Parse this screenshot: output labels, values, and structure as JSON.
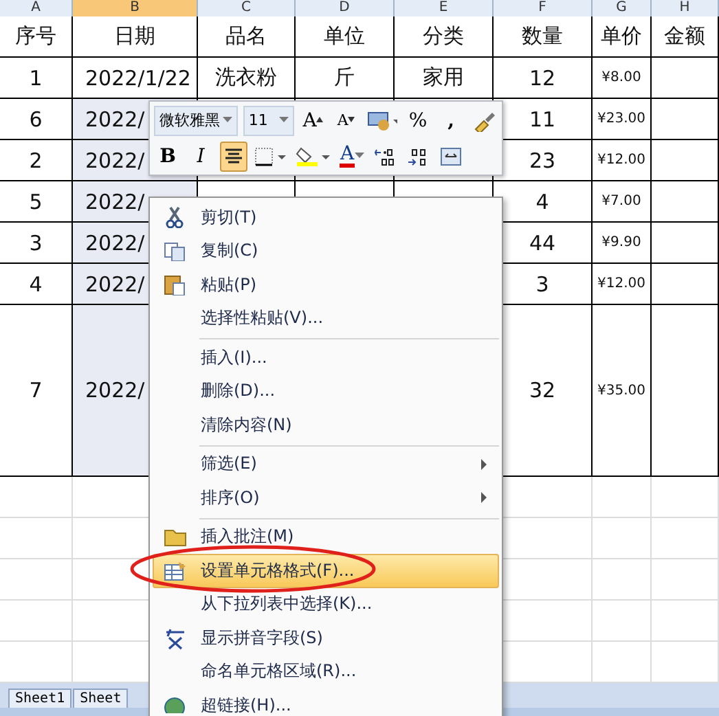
{
  "columns": [
    {
      "letter": "A",
      "selected": false
    },
    {
      "letter": "B",
      "selected": true
    },
    {
      "letter": "C",
      "selected": false
    },
    {
      "letter": "D",
      "selected": false
    },
    {
      "letter": "E",
      "selected": false
    },
    {
      "letter": "F",
      "selected": false
    },
    {
      "letter": "G",
      "selected": false
    },
    {
      "letter": "H",
      "selected": false
    }
  ],
  "header": [
    "序号",
    "日期",
    "品名",
    "单位",
    "分类",
    "数量",
    "单价",
    "金额"
  ],
  "rows": [
    {
      "cells": [
        "1",
        "2022/1/22",
        "洗衣粉",
        "斤",
        "家用",
        "12",
        "¥8.00",
        ""
      ],
      "selected": false,
      "tall": false
    },
    {
      "cells": [
        "6",
        "2022/",
        "",
        "",
        "",
        "11",
        "¥23.00",
        ""
      ],
      "selected": true,
      "tall": false
    },
    {
      "cells": [
        "2",
        "2022/",
        "",
        "",
        "",
        "23",
        "¥12.00",
        ""
      ],
      "selected": true,
      "tall": false
    },
    {
      "cells": [
        "5",
        "2022/",
        "",
        "",
        "",
        "4",
        "¥7.00",
        ""
      ],
      "selected": true,
      "tall": false
    },
    {
      "cells": [
        "3",
        "2022/",
        "",
        "",
        "",
        "44",
        "¥9.90",
        ""
      ],
      "selected": true,
      "tall": false
    },
    {
      "cells": [
        "4",
        "2022/",
        "",
        "",
        "",
        "3",
        "¥12.00",
        ""
      ],
      "selected": true,
      "tall": false
    },
    {
      "cells": [
        "7",
        "2022/",
        "",
        "",
        "",
        "32",
        "¥35.00",
        ""
      ],
      "selected": true,
      "tall": true
    }
  ],
  "sheet_tabs": [
    {
      "label": "Sheet1",
      "selected": false
    },
    {
      "label": "Sheet",
      "selected": false
    }
  ],
  "mini_toolbar": {
    "font": "微软雅黑",
    "size": "11",
    "row1": [
      {
        "kind": "grow",
        "label": "A"
      },
      {
        "kind": "shrink",
        "label": "A"
      },
      {
        "kind": "currency"
      },
      {
        "kind": "percent",
        "label": "%"
      },
      {
        "kind": "comma",
        "label": ","
      },
      {
        "kind": "brush"
      }
    ],
    "row2": [
      {
        "kind": "bold",
        "label": "B",
        "pressed": false
      },
      {
        "kind": "italic",
        "label": "I",
        "pressed": false
      },
      {
        "kind": "align",
        "pressed": true
      },
      {
        "kind": "border",
        "pressed": false
      },
      {
        "kind": "fill",
        "pressed": false
      },
      {
        "kind": "fontcolor",
        "label": "A",
        "pressed": false
      },
      {
        "kind": "incdec",
        "pressed": false
      },
      {
        "kind": "decdec",
        "pressed": false
      },
      {
        "kind": "merge",
        "pressed": false
      }
    ]
  },
  "context_menu": [
    {
      "kind": "cut",
      "label": "剪切(T)",
      "selected": false
    },
    {
      "kind": "copy",
      "label": "复制(C)",
      "selected": false
    },
    {
      "kind": "paste",
      "label": "粘贴(P)",
      "selected": false
    },
    {
      "kind": "plain",
      "label": "选择性粘贴(V)...",
      "selected": false
    },
    {
      "kind": "separator"
    },
    {
      "kind": "plain",
      "label": "插入(I)...",
      "selected": false
    },
    {
      "kind": "plain",
      "label": "删除(D)...",
      "selected": false
    },
    {
      "kind": "plain",
      "label": "清除内容(N)",
      "selected": false
    },
    {
      "kind": "separator"
    },
    {
      "kind": "submenu",
      "label": "筛选(E)",
      "selected": false
    },
    {
      "kind": "submenu",
      "label": "排序(O)",
      "selected": false
    },
    {
      "kind": "separator"
    },
    {
      "kind": "comment",
      "label": "插入批注(M)",
      "selected": false
    },
    {
      "kind": "format",
      "label": "设置单元格格式(F)...",
      "selected": true,
      "circled": true
    },
    {
      "kind": "plain",
      "label": "从下拉列表中选择(K)...",
      "selected": false
    },
    {
      "kind": "pinyin",
      "label": "显示拼音字段(S)",
      "selected": false
    },
    {
      "kind": "plain",
      "label": "命名单元格区域(R)...",
      "selected": false
    },
    {
      "kind": "hyperlink",
      "label": "超链接(H)...",
      "selected": false
    }
  ]
}
